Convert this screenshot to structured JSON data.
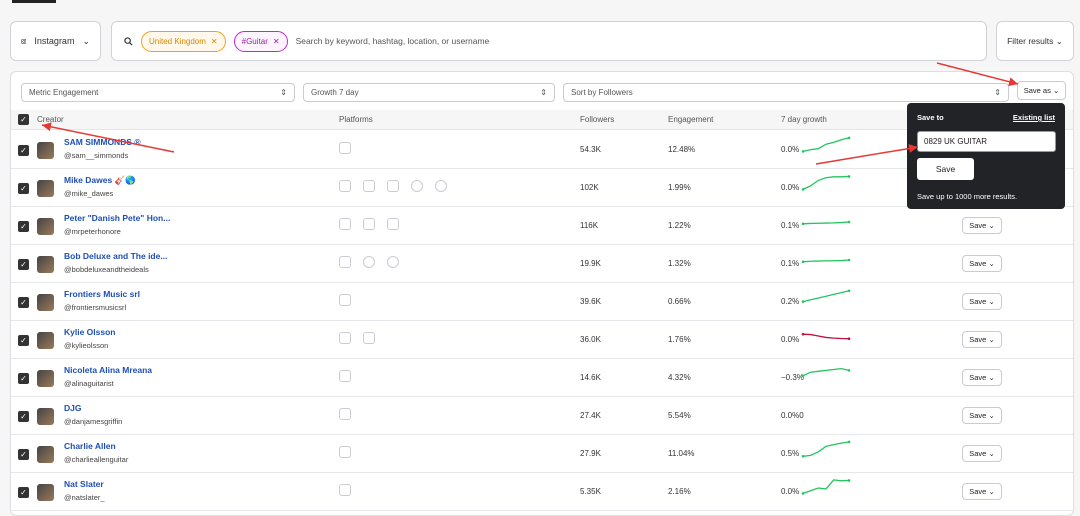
{
  "top": {
    "platform": "Instagram",
    "chips": [
      "United Kingdom",
      "#Guitar"
    ],
    "search_placeholder": "Search by keyword, hashtag, location, or username",
    "filter": "Filter results"
  },
  "controls": {
    "metric": "Metric Engagement",
    "growth": "Growth 7 day",
    "sort": "Sort by Followers",
    "save_as": "Save as"
  },
  "columns": {
    "creator": "Creator",
    "platforms": "Platforms",
    "followers": "Followers",
    "engagement": "Engagement",
    "growth": "7 day growth"
  },
  "rows": [
    {
      "name": "SAM SIMMONDS ®",
      "handle": "@sam__simmonds",
      "platform_icons": [
        "instagram"
      ],
      "followers": "54.3K",
      "engagement": "12.48%",
      "growth": "0.0%",
      "trend": [
        0.2,
        0.3,
        0.35,
        0.6,
        0.7,
        0.85,
        0.95
      ],
      "trend_color": "#22c55e",
      "save": ""
    },
    {
      "name": "Mike Dawes 🎸🌎",
      "handle": "@mike_dawes",
      "platform_icons": [
        "instagram",
        "twitter",
        "youtube",
        "facebook",
        "rss"
      ],
      "followers": "102K",
      "engagement": "1.99%",
      "growth": "0.0%",
      "trend": [
        0.2,
        0.4,
        0.7,
        0.85,
        0.9,
        0.9,
        0.92
      ],
      "trend_color": "#22c55e",
      "save": ""
    },
    {
      "name": "Peter \"Danish Pete\" Hon...",
      "handle": "@mrpeterhonore",
      "platform_icons": [
        "instagram",
        "twitter",
        "youtube"
      ],
      "followers": "116K",
      "engagement": "1.22%",
      "growth": "0.1%",
      "trend": [
        0.4,
        0.42,
        0.43,
        0.44,
        0.45,
        0.47,
        0.5
      ],
      "trend_color": "#22c55e",
      "save": "Save"
    },
    {
      "name": "Bob Deluxe and The ide...",
      "handle": "@bobdeluxeandtheideals",
      "platform_icons": [
        "instagram",
        "facebook",
        "rss"
      ],
      "followers": "19.9K",
      "engagement": "1.32%",
      "growth": "0.1%",
      "trend": [
        0.4,
        0.43,
        0.44,
        0.45,
        0.46,
        0.47,
        0.5
      ],
      "trend_color": "#22c55e",
      "save": "Save"
    },
    {
      "name": "Frontiers Music srl",
      "handle": "@frontiersmusicsrl",
      "platform_icons": [
        "instagram"
      ],
      "followers": "39.6K",
      "engagement": "0.66%",
      "growth": "0.2%",
      "trend": [
        0.3,
        0.4,
        0.5,
        0.6,
        0.7,
        0.8,
        0.9
      ],
      "trend_color": "#22c55e",
      "save": "Save"
    },
    {
      "name": "Kylie Olsson",
      "handle": "@kylieolsson",
      "platform_icons": [
        "instagram",
        "twitter"
      ],
      "followers": "36.0K",
      "engagement": "1.76%",
      "growth": "0.0%",
      "trend": [
        0.6,
        0.58,
        0.5,
        0.42,
        0.38,
        0.36,
        0.35
      ],
      "trend_color": "#be123c",
      "save": "Save"
    },
    {
      "name": "Nicoleta Alina Mreana",
      "handle": "@alinaguitarist",
      "platform_icons": [
        "instagram"
      ],
      "followers": "14.6K",
      "engagement": "4.32%",
      "growth": "−0.3%",
      "trend": [
        0.4,
        0.6,
        0.65,
        0.7,
        0.75,
        0.8,
        0.7
      ],
      "trend_color": "#22c55e",
      "save": "Save"
    },
    {
      "name": "DJG",
      "handle": "@danjamesgriffin",
      "platform_icons": [
        "instagram"
      ],
      "followers": "27.4K",
      "engagement": "5.54%",
      "growth": "0.0%0",
      "trend": [],
      "trend_color": "#22c55e",
      "save": "Save"
    },
    {
      "name": "Charlie Allen",
      "handle": "@charlieallenguitar",
      "platform_icons": [
        "instagram"
      ],
      "followers": "27.9K",
      "engagement": "11.04%",
      "growth": "0.5%",
      "trend": [
        0.15,
        0.2,
        0.4,
        0.7,
        0.8,
        0.88,
        0.95
      ],
      "trend_color": "#22c55e",
      "save": "Save"
    },
    {
      "name": "Nat Slater",
      "handle": "@natslater_",
      "platform_icons": [
        "instagram"
      ],
      "followers": "5.35K",
      "engagement": "2.16%",
      "growth": "0.0%",
      "trend": [
        0.2,
        0.35,
        0.5,
        0.45,
        0.95,
        0.9,
        0.92
      ],
      "trend_color": "#22c55e",
      "save": "Save"
    }
  ],
  "popover": {
    "title": "Save to",
    "existing": "Existing list",
    "value": "0829 UK GUITAR",
    "button": "Save",
    "note": "Save up to 1000 more results."
  },
  "colors": {
    "link": "#1e4fb4",
    "arrow": "#e53935"
  }
}
